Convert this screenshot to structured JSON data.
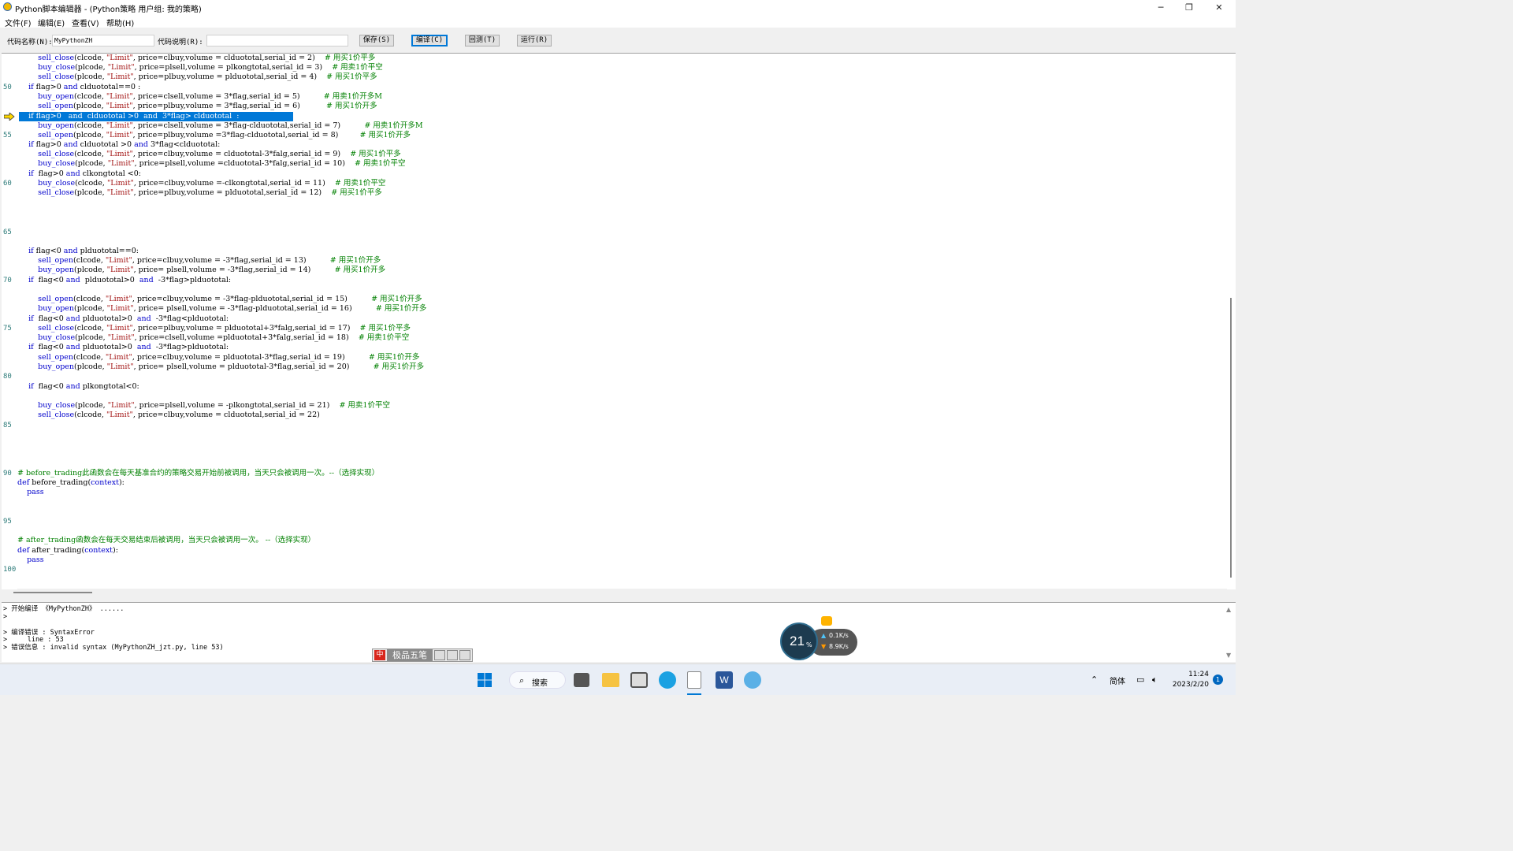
{
  "window": {
    "title": "Python脚本编辑器 - (Python策略 用户组: 我的策略)",
    "controls": [
      "─",
      "❐",
      "✕"
    ]
  },
  "menu": [
    "文件(F)",
    "编辑(E)",
    "查看(V)",
    "帮助(H)"
  ],
  "toolbar": {
    "name_label": "代码名称(N):",
    "name_value": "MyPythonZH",
    "desc_label": "代码说明(R):",
    "desc_value": "",
    "save": "保存(S)",
    "compile": "编译(C)",
    "backtest": "回测(T)",
    "run": "运行(R)"
  },
  "line_numbers": [
    "50",
    "55",
    "60",
    "65",
    "70",
    "75",
    "80",
    "85",
    "90",
    "95",
    "100"
  ],
  "code": {
    "l46": {
      "a": "        ",
      "fn": "sell_close",
      "b": "(clcode, ",
      "s": "\"Limit\"",
      "c": ", price=clbuy,volume = clduototal,serial_id = 2)    ",
      "cm": "# 用买1价平多"
    },
    "l47": {
      "a": "        ",
      "fn": "buy_close",
      "b": "(plcode, ",
      "s": "\"Limit\"",
      "c": ", price=plsell,volume = plkongtotal,serial_id = 3)    ",
      "cm": "# 用卖1价平空"
    },
    "l48": {
      "a": "        ",
      "fn": "sell_close",
      "b": "(plcode, ",
      "s": "\"Limit\"",
      "c": ", price=plbuy,volume = plduototal,serial_id = 4)    ",
      "cm": "# 用买1价平多"
    },
    "l50": {
      "kw": "    if",
      "b": " flag>0 ",
      "kw2": "and",
      "c": " clduototal==0 :"
    },
    "l51": {
      "a": "        ",
      "fn": "buy_open",
      "b": "(clcode, ",
      "s": "\"Limit\"",
      "c": ", price=clsell,volume = 3*flag,serial_id = 5)          ",
      "cm": "# 用卖1价开多M"
    },
    "l52": {
      "a": "        ",
      "fn": "sell_open",
      "b": "(plcode, ",
      "s": "\"Limit\"",
      "c": ", price=plbuy,volume = 3*flag,serial_id = 6)           ",
      "cm": "# 用买1价开多"
    },
    "l53": "    if flag>0   and  clduototal >0  and  3*flag> clduototal  :",
    "l54": {
      "a": "        ",
      "fn": "buy_open",
      "b": "(clcode, ",
      "s": "\"Limit\"",
      "c": ", price=clsell,volume = 3*flag-clduototal,serial_id = 7)          ",
      "cm": "# 用卖1价开多M"
    },
    "l55": {
      "a": "        ",
      "fn": "sell_open",
      "b": "(plcode, ",
      "s": "\"Limit\"",
      "c": ", price=plbuy,volume =3*flag-clduototal,serial_id = 8)         ",
      "cm": "# 用买1价开多"
    },
    "l56": {
      "kw": "    if",
      "b": " flag>0 ",
      "kw2": "and",
      "c": " clduototal >0 ",
      "kw3": "and",
      "d": " 3*flag<clduototal:"
    },
    "l57": {
      "a": "        ",
      "fn": "sell_close",
      "b": "(clcode, ",
      "s": "\"Limit\"",
      "c": ", price=clbuy,volume = clduototal-3*falg,serial_id = 9)    ",
      "cm": "# 用买1价平多"
    },
    "l58": {
      "a": "        ",
      "fn": "buy_close",
      "b": "(plcode, ",
      "s": "\"Limit\"",
      "c": ", price=plsell,volume =clduototal-3*falg,serial_id = 10)    ",
      "cm": "# 用卖1价平空"
    },
    "l59": {
      "kw": "    if",
      "b": "  flag>0 ",
      "kw2": "and",
      "c": " clkongtotal <0:"
    },
    "l60": {
      "a": "        ",
      "fn": "buy_close",
      "b": "(clcode, ",
      "s": "\"Limit\"",
      "c": ", price=clbuy,volume =-clkongtotal,serial_id = 11)    ",
      "cm": "# 用卖1价平空"
    },
    "l61": {
      "a": "        ",
      "fn": "sell_close",
      "b": "(plcode, ",
      "s": "\"Limit\"",
      "c": ", price=plbuy,volume = plduototal,serial_id = 12)    ",
      "cm": "# 用买1价平多"
    },
    "l67": {
      "kw": "    if",
      "b": " flag<0 ",
      "kw2": "and",
      "c": " plduototal==0:"
    },
    "l68": {
      "a": "        ",
      "fn": "sell_open",
      "b": "(clcode, ",
      "s": "\"Limit\"",
      "c": ", price=clbuy,volume = -3*flag,serial_id = 13)          ",
      "cm": "# 用买1价开多"
    },
    "l69": {
      "a": "        ",
      "fn": "buy_open",
      "b": "(plcode, ",
      "s": "\"Limit\"",
      "c": ", price= plsell,volume = -3*flag,serial_id = 14)          ",
      "cm": "# 用买1价开多"
    },
    "l70": {
      "kw": "    if",
      "b": "  flag<0 ",
      "kw2": "and",
      "c": "  plduototal>0  ",
      "kw3": "and",
      "d": "  -3*flag>plduototal:"
    },
    "l72": {
      "a": "        ",
      "fn": "sell_open",
      "b": "(clcode, ",
      "s": "\"Limit\"",
      "c": ", price=clbuy,volume = -3*flag-plduototal,serial_id = 15)          ",
      "cm": "# 用买1价开多"
    },
    "l73": {
      "a": "        ",
      "fn": "buy_open",
      "b": "(plcode, ",
      "s": "\"Limit\"",
      "c": ", price= plsell,volume = -3*flag-plduototal,serial_id = 16)          ",
      "cm": "# 用买1价开多"
    },
    "l74": {
      "kw": "    if",
      "b": "  flag<0 ",
      "kw2": "and",
      "c": " plduototal>0  ",
      "kw3": "and",
      "d": "  -3*flag<plduototal:"
    },
    "l75": {
      "a": "        ",
      "fn": "sell_close",
      "b": "(clcode, ",
      "s": "\"Limit\"",
      "c": ", price=plbuy,volume = plduototal+3*falg,serial_id = 17)    ",
      "cm": "# 用买1价平多"
    },
    "l76": {
      "a": "        ",
      "fn": "buy_close",
      "b": "(plcode, ",
      "s": "\"Limit\"",
      "c": ", price=clsell,volume =plduototal+3*falg,serial_id = 18)    ",
      "cm": "# 用卖1价平空"
    },
    "l77": {
      "kw": "    if",
      "b": "  flag<0 ",
      "kw2": "and",
      "c": " plduototal>0  ",
      "kw3": "and",
      "d": "  -3*flag>plduototal:"
    },
    "l78": {
      "a": "        ",
      "fn": "sell_open",
      "b": "(clcode, ",
      "s": "\"Limit\"",
      "c": ", price=clbuy,volume = plduototal-3*flag,serial_id = 19)          ",
      "cm": "# 用买1价开多"
    },
    "l79": {
      "a": "        ",
      "fn": "buy_open",
      "b": "(plcode, ",
      "s": "\"Limit\"",
      "c": ", price= plsell,volume = plduototal-3*flag,serial_id = 20)          ",
      "cm": "# 用买1价开多"
    },
    "l81": {
      "kw": "    if",
      "b": "  flag<0 ",
      "kw2": "and",
      "c": " plkongtotal<0:"
    },
    "l83": {
      "a": "        ",
      "fn": "buy_close",
      "b": "(plcode, ",
      "s": "\"Limit\"",
      "c": ", price=plsell,volume = -plkongtotal,serial_id = 21)    ",
      "cm": "# 用卖1价平空"
    },
    "l84": {
      "a": "        ",
      "fn": "sell_close",
      "b": "(clcode, ",
      "s": "\"Limit\"",
      "c": ", price=clbuy,volume = clduototal,serial_id = 22)"
    },
    "l90": "# before_trading此函数会在每天基准合约的策略交易开始前被调用，当天只会被调用一次。--（选择实现）",
    "l91": {
      "kw": "def",
      "b": " before_trading(",
      "p": "context",
      "c": "):"
    },
    "l92": "    pass",
    "l97": "# after_trading函数会在每天交易结束后被调用，当天只会被调用一次。 --（选择实现）",
    "l98": {
      "kw": "def",
      "b": " after_trading(",
      "p": "context",
      "c": "):"
    },
    "l99": "    pass"
  },
  "output": [
    "> 开始编译 《MyPythonZH》 ......",
    ">",
    "",
    "> 编译错误 : SyntaxError",
    ">     line : 53",
    "> 错误信息 : invalid syntax (MyPythonZH_jzt.py, line 53)"
  ],
  "ime": {
    "label": "极品五笔",
    "mode": "中"
  },
  "net": {
    "cpu": "21",
    "unit": "%",
    "up": "0.1",
    "down": "8.9",
    "rate_unit": "K/s"
  },
  "taskbar": {
    "search": "搜索",
    "lang": "简体",
    "time": "11:24",
    "date": "2023/2/20",
    "badge": "1"
  },
  "colors": {
    "accent": "#0078d7",
    "keyword": "#0000cc",
    "string": "#a31515",
    "comment": "#008000",
    "lineno": "#2b7a78"
  }
}
